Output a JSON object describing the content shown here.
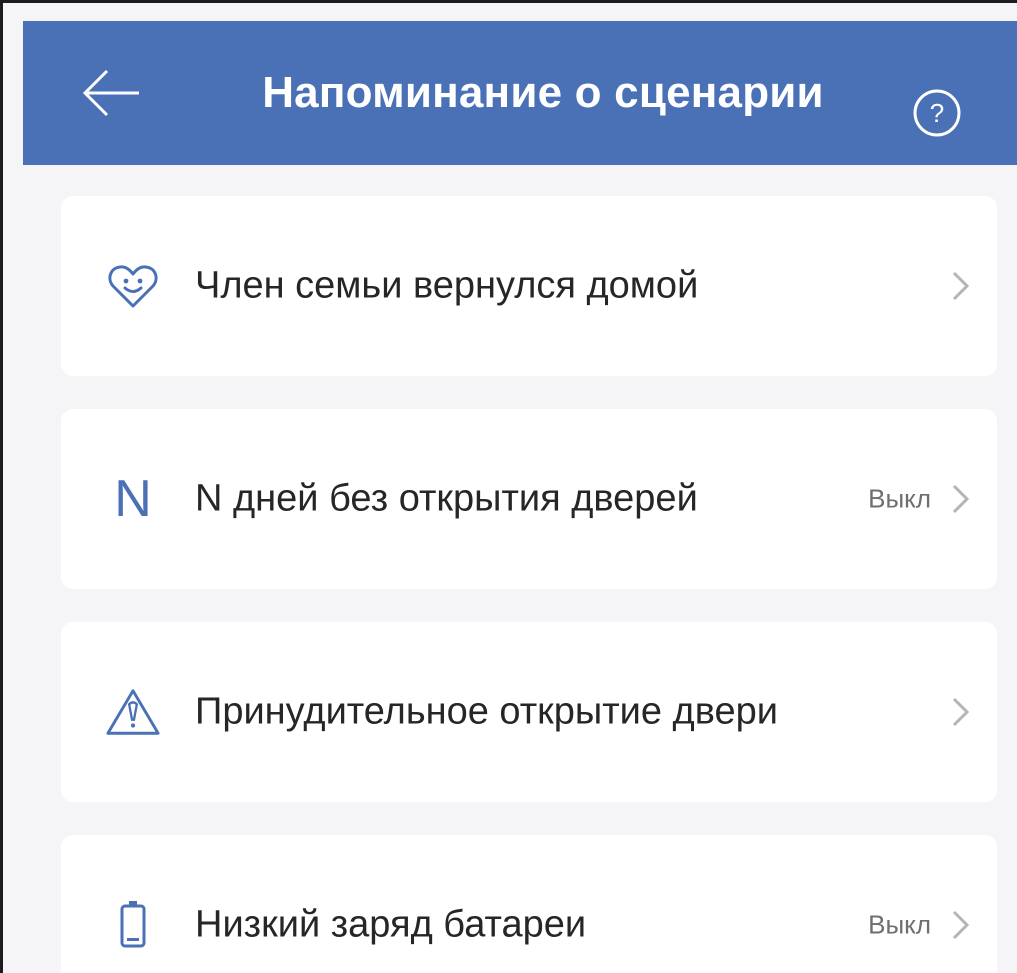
{
  "header": {
    "title": "Напоминание о сценарии",
    "back_icon": "arrow-left-icon",
    "help_icon": "question-circle-icon",
    "background": "#4a70b5"
  },
  "items": [
    {
      "icon": "heart-smile-icon",
      "label": "Член семьи вернулся домой",
      "status": ""
    },
    {
      "icon": "letter-n-icon",
      "icon_text": "N",
      "label": "N дней без открытия дверей",
      "status": "Выкл"
    },
    {
      "icon": "warning-triangle-icon",
      "label": "Принудительное открытие двери",
      "status": ""
    },
    {
      "icon": "battery-icon",
      "label": "Низкий заряд батареи",
      "status": "Выкл"
    }
  ],
  "colors": {
    "accent": "#4a70b5",
    "page_bg": "#f5f5f7",
    "card_bg": "#ffffff",
    "text": "#262626",
    "muted": "#6f6f6f"
  }
}
